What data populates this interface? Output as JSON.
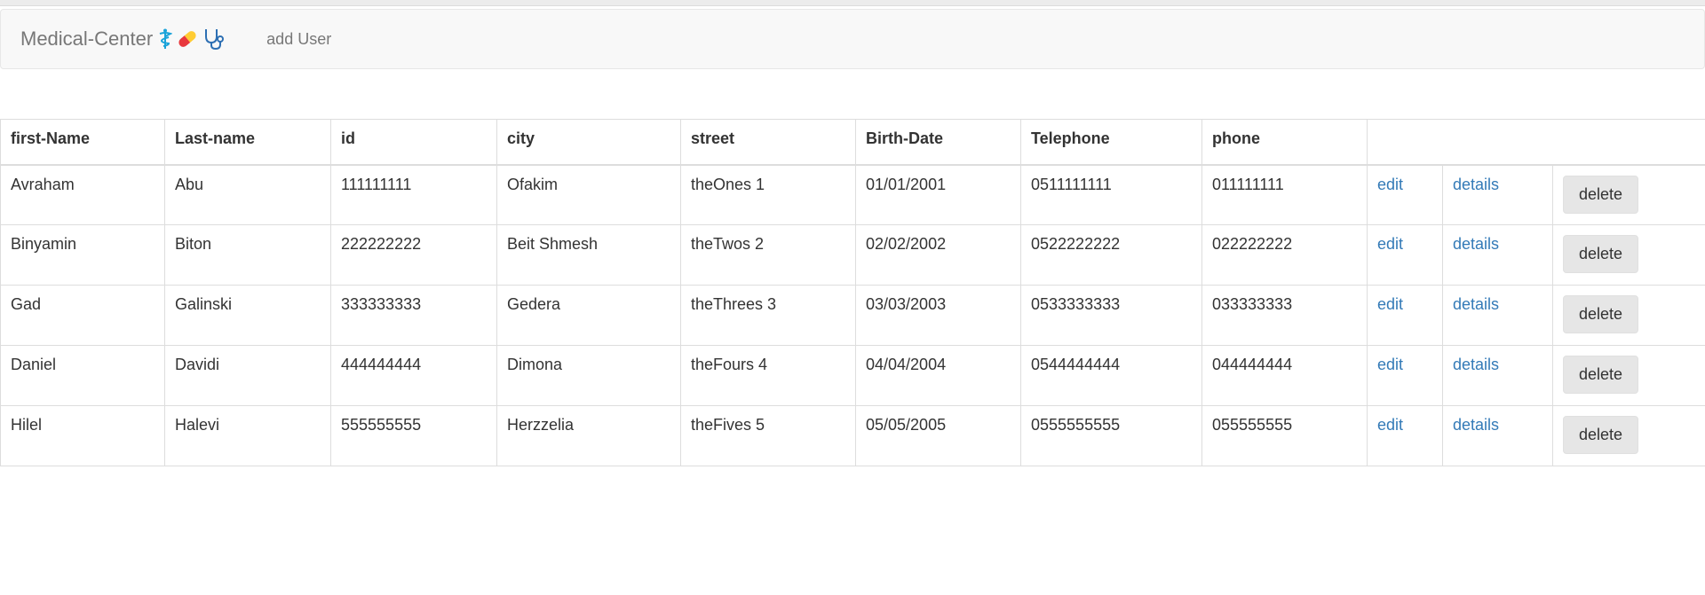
{
  "navbar": {
    "brand": "Medical-Center",
    "add_user": "add User",
    "brand_icons": [
      "caduceus-icon",
      "pill-icon",
      "stethoscope-icon"
    ]
  },
  "colors": {
    "link": "#337ab7",
    "navbar_bg": "#f8f8f8",
    "brand_text": "#777777",
    "delete_button_bg": "#e6e6e6"
  },
  "table": {
    "headers": [
      "first-Name",
      "Last-name",
      "id",
      "city",
      "street",
      "Birth-Date",
      "Telephone",
      "phone"
    ],
    "rows": [
      {
        "first_name": "Avraham",
        "last_name": "Abu",
        "id": "111111111",
        "city": "Ofakim",
        "street": "theOnes 1",
        "birth_date": "01/01/2001",
        "telephone": "0511111111",
        "phone": "011111111"
      },
      {
        "first_name": "Binyamin",
        "last_name": "Biton",
        "id": "222222222",
        "city": "Beit Shmesh",
        "street": "theTwos 2",
        "birth_date": "02/02/2002",
        "telephone": "0522222222",
        "phone": "022222222"
      },
      {
        "first_name": "Gad",
        "last_name": "Galinski",
        "id": "333333333",
        "city": "Gedera",
        "street": "theThrees 3",
        "birth_date": "03/03/2003",
        "telephone": "0533333333",
        "phone": "033333333"
      },
      {
        "first_name": "Daniel",
        "last_name": "Davidi",
        "id": "444444444",
        "city": "Dimona",
        "street": "theFours 4",
        "birth_date": "04/04/2004",
        "telephone": "0544444444",
        "phone": "044444444"
      },
      {
        "first_name": "Hilel",
        "last_name": "Halevi",
        "id": "555555555",
        "city": "Herzzelia",
        "street": "theFives 5",
        "birth_date": "05/05/2005",
        "telephone": "0555555555",
        "phone": "055555555"
      }
    ],
    "actions": {
      "edit": "edit",
      "details": "details",
      "delete": "delete"
    }
  }
}
